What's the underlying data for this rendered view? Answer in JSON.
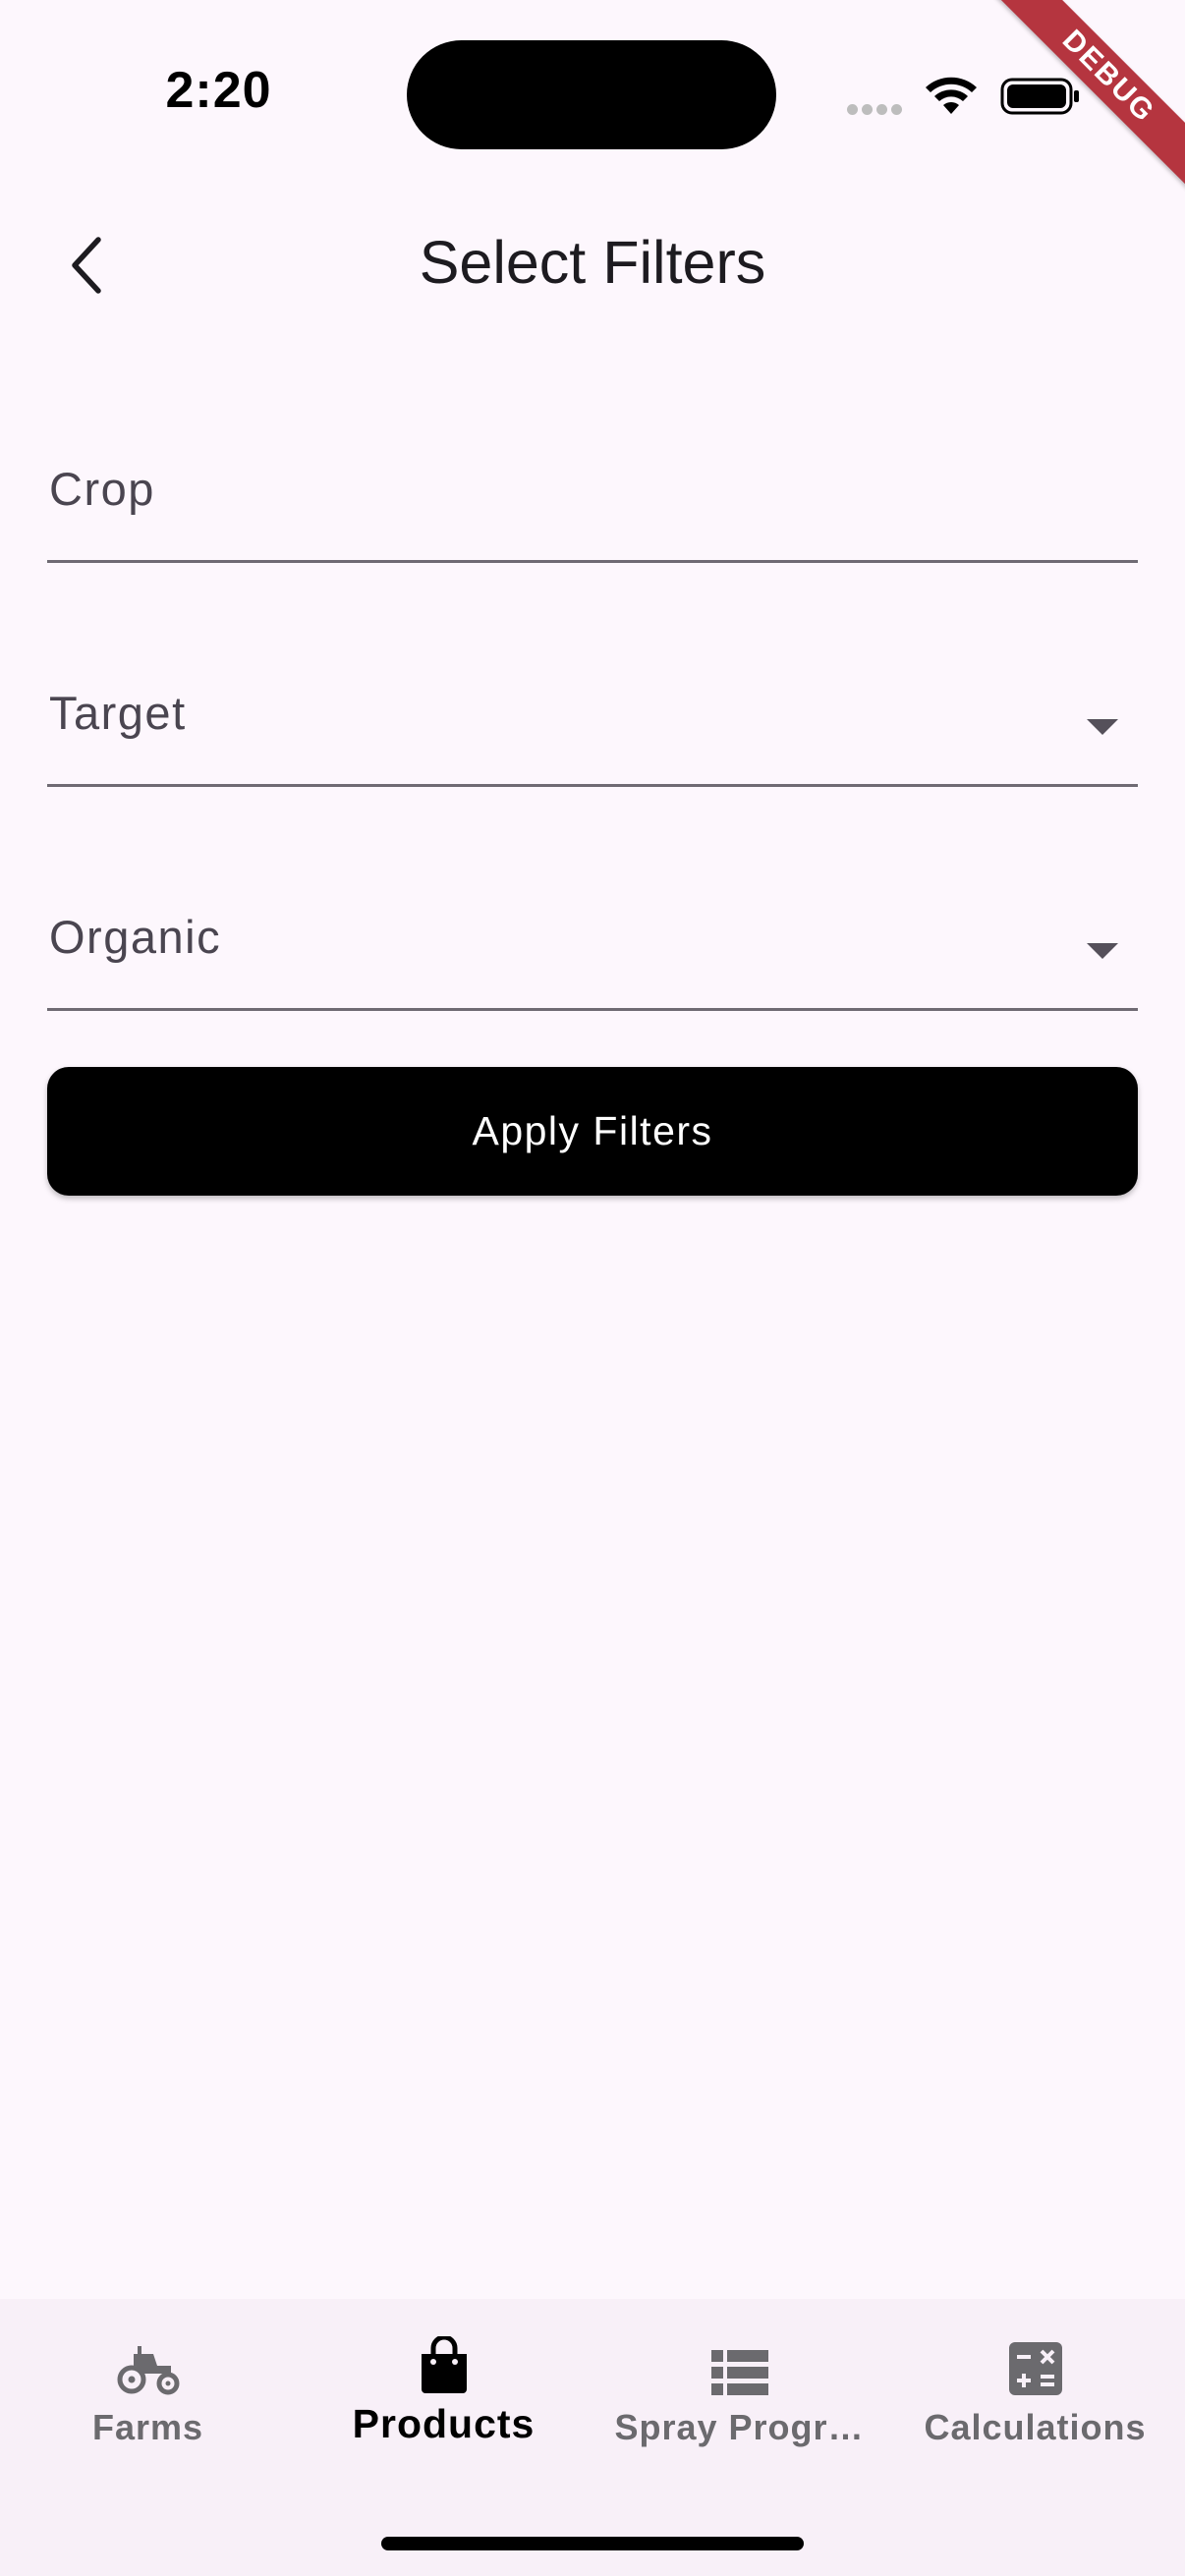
{
  "status_bar": {
    "time": "2:20"
  },
  "debug_banner": {
    "label": "DEBUG"
  },
  "app_bar": {
    "title": "Select Filters",
    "back_icon": "chevron-left-icon"
  },
  "form": {
    "fields": [
      {
        "label": "Crop",
        "type": "text"
      },
      {
        "label": "Target",
        "type": "dropdown"
      },
      {
        "label": "Organic",
        "type": "dropdown"
      }
    ],
    "apply_label": "Apply Filters"
  },
  "bottom_nav": {
    "items": [
      {
        "label": "Farms",
        "icon": "tractor-icon",
        "active": false
      },
      {
        "label": "Products",
        "icon": "shopping-bag-icon",
        "active": true
      },
      {
        "label": "Spray Progr…",
        "icon": "list-icon",
        "active": false
      },
      {
        "label": "Calculations",
        "icon": "calculator-icon",
        "active": false
      }
    ]
  },
  "colors": {
    "background": "#fdf7fd",
    "nav_background": "#f8f0f8",
    "primary_button": "#000000",
    "debug_ribbon": "#b5353f",
    "inactive_nav": "#6b6a6e"
  }
}
